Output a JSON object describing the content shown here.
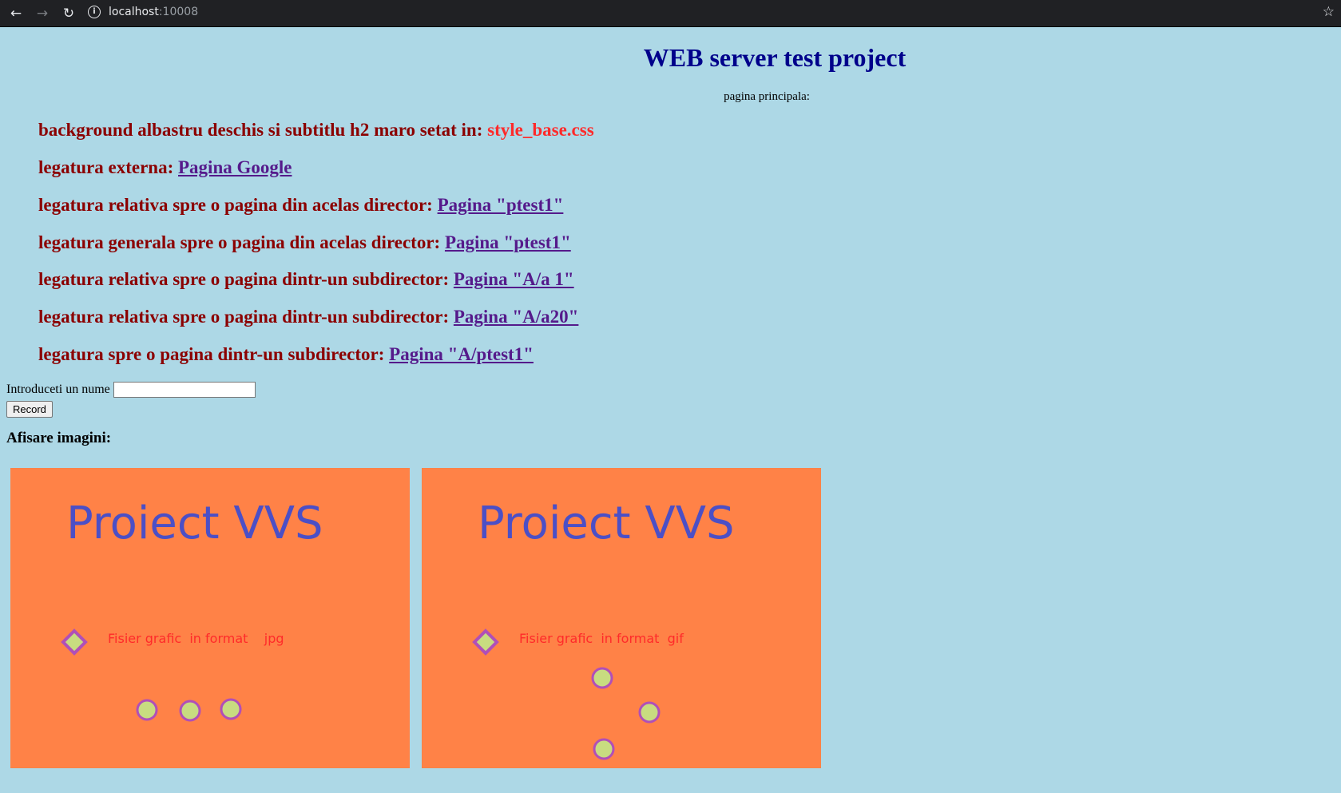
{
  "browser": {
    "url_host": "localhost",
    "url_port": ":10008"
  },
  "page": {
    "title": "WEB server test project",
    "subtitle": "pagina principala:",
    "rows": [
      {
        "text": "background albastru deschis si subtitlu h2 maro setat in: ",
        "highlight": "style_base.css"
      },
      {
        "text": "legatura externa: ",
        "link": "Pagina Google"
      },
      {
        "text": "legatura relativa spre o pagina din acelas director: ",
        "link": "Pagina \"ptest1\""
      },
      {
        "text": "legatura generala spre o pagina din acelas director: ",
        "link": "Pagina \"ptest1\""
      },
      {
        "text": "legatura relativa spre o pagina dintr-un subdirector: ",
        "link": "Pagina \"A/a 1\""
      },
      {
        "text": "legatura relativa spre o pagina dintr-un subdirector: ",
        "link": "Pagina \"A/a20\""
      },
      {
        "text": "legatura spre o pagina dintr-un subdirector: ",
        "link": "Pagina \"A/ptest1\""
      }
    ],
    "form": {
      "label": "Introduceti un nume",
      "input_value": "",
      "button_label": "Record"
    },
    "images_heading": "Afisare imagini:",
    "images": [
      {
        "title": "Proiect VVS",
        "caption": "Fisier grafic  in format    jpg"
      },
      {
        "title": "Proiect VVS",
        "caption": "Fisier grafic  in format  gif"
      }
    ]
  },
  "colors": {
    "background": "#add8e6",
    "title": "#00008b",
    "row_text": "#8b0000",
    "link": "#551a8b",
    "highlight": "#ff2a2a",
    "slide_bg": "#ff8247",
    "slide_title": "#4b4fc6"
  },
  "icons": [
    "back-arrow-icon",
    "forward-arrow-icon",
    "reload-icon",
    "info-icon",
    "star-icon"
  ]
}
